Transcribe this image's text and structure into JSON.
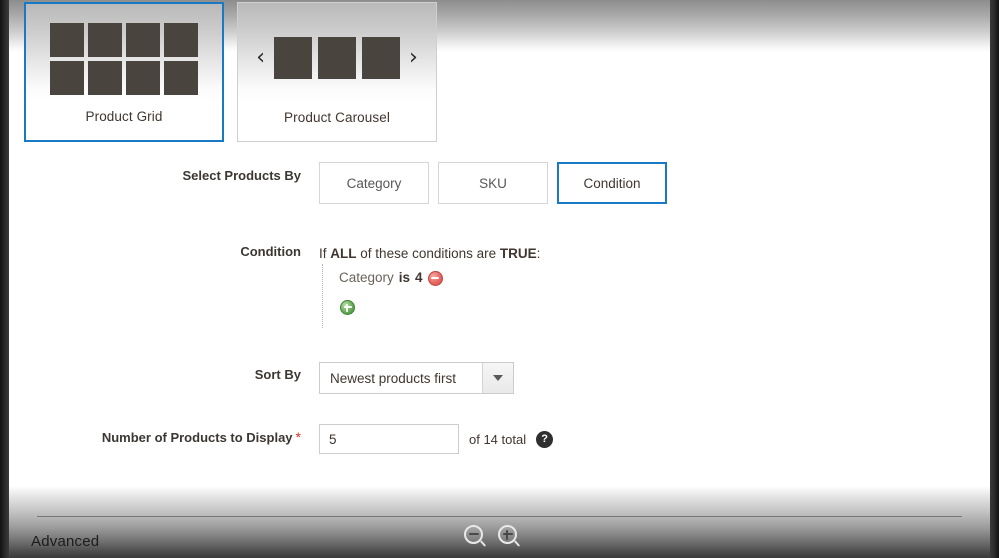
{
  "templates": {
    "cards": [
      {
        "label": "Product Grid",
        "art": "grid-icon",
        "selected": true
      },
      {
        "label": "Product Carousel",
        "art": "carousel-icon",
        "selected": false
      }
    ]
  },
  "form": {
    "select_products_by": {
      "label": "Select Products By",
      "options": [
        {
          "label": "Category",
          "active": false
        },
        {
          "label": "SKU",
          "active": false
        },
        {
          "label": "Condition",
          "active": true
        }
      ]
    },
    "condition": {
      "label": "Condition",
      "header_prefix": "If",
      "header_all": "ALL",
      "header_middle": "of these conditions are",
      "header_true": "TRUE",
      "header_suffix": ":",
      "rules": [
        {
          "attribute": "Category",
          "operator": "is",
          "value": "4"
        }
      ]
    },
    "sort_by": {
      "label": "Sort By",
      "value": "Newest products first"
    },
    "number_of_products": {
      "label": "Number of Products to Display",
      "required_marker": "*",
      "value": "5",
      "placeholder": "",
      "total_text": "of 14 total",
      "help_glyph": "?"
    }
  },
  "footer": {
    "advanced_label": "Advanced",
    "zoom_out": "zoom-out-icon",
    "zoom_in": "zoom-in-icon"
  },
  "colors": {
    "accent_blue": "#1979c3",
    "thumb_dark": "#4a443f",
    "required_red": "#e02b27",
    "remove_red": "#cf4842",
    "add_green": "#3f8f36"
  }
}
